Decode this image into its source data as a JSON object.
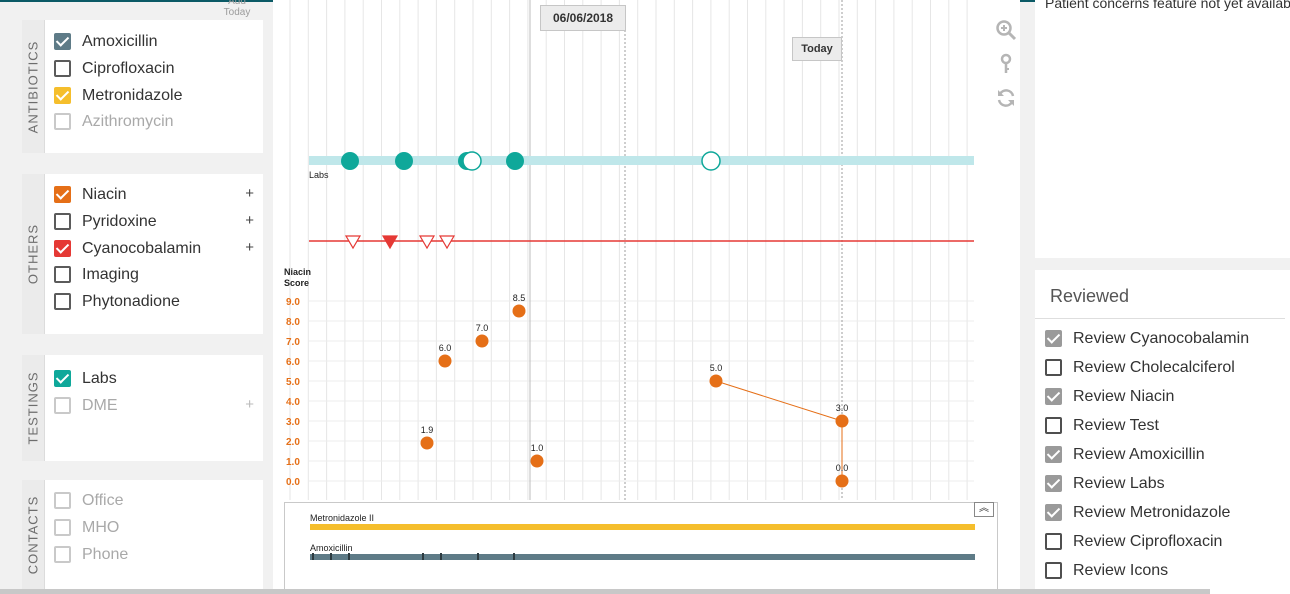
{
  "left": {
    "add_today": "Add Today",
    "groups": [
      {
        "label": "ANTIBIOTICS",
        "items": [
          {
            "label": "Amoxicillin",
            "checked": true,
            "color": "#5e7b87"
          },
          {
            "label": "Ciprofloxacin",
            "checked": false
          },
          {
            "label": "Metronidazole",
            "checked": true,
            "color": "#f5be2c"
          },
          {
            "label": "Azithromycin",
            "checked": false,
            "disabled": true
          }
        ]
      },
      {
        "label": "OTHERS",
        "items": [
          {
            "label": "Niacin",
            "checked": true,
            "color": "#e56f17",
            "plus": "+"
          },
          {
            "label": "Pyridoxine",
            "checked": false,
            "plus": "+"
          },
          {
            "label": "Cyanocobalamin",
            "checked": true,
            "color": "#e53935",
            "plus": "+"
          },
          {
            "label": "Imaging",
            "checked": false
          },
          {
            "label": "Phytonadione",
            "checked": false
          }
        ]
      },
      {
        "label": "TESTINGS",
        "items": [
          {
            "label": "Labs",
            "checked": true,
            "color": "#0fa89a"
          },
          {
            "label": "DME",
            "checked": false,
            "disabled": true,
            "plus": "+"
          }
        ]
      },
      {
        "label": "CONTACTS",
        "items": [
          {
            "label": "Office",
            "checked": false,
            "disabled": true
          },
          {
            "label": "MHO",
            "checked": false,
            "disabled": true
          },
          {
            "label": "Phone",
            "checked": false,
            "disabled": true
          }
        ]
      }
    ]
  },
  "timeline": {
    "selected_date": "06/06/2018",
    "today_label": "Today",
    "labs_label": "Labs",
    "labs_color": "#bfe7ea",
    "labs_dot_color": "#0fa89a",
    "event_line_color": "#e53935",
    "score_label_1": "Niacin",
    "score_label_2": "Score",
    "bar1_label": "Metronidazole II",
    "bar1_color": "#f5be2c",
    "bar2_label": "Amoxicillin",
    "bar2_color": "#5e7b87",
    "collapse_icon": "chevron-up-icon",
    "tools": [
      "zoom-in-icon",
      "key-icon",
      "refresh-icon"
    ]
  },
  "chart_data": {
    "type": "scatter",
    "ylabel": "Niacin Score",
    "ylim": [
      0,
      9
    ],
    "y_ticks": [
      "9.0",
      "8.0",
      "7.0",
      "6.0",
      "5.0",
      "4.0",
      "3.0",
      "2.0",
      "1.0",
      "0.0"
    ],
    "series": [
      {
        "name": "Niacin",
        "color": "#e56f17",
        "points": [
          {
            "label": "1.9",
            "y": 1.9
          },
          {
            "label": "6.0",
            "y": 6.0
          },
          {
            "label": "7.0",
            "y": 7.0
          },
          {
            "label": "8.5",
            "y": 8.5
          },
          {
            "label": "1.0",
            "y": 1.0
          },
          {
            "label": "5.0",
            "y": 5.0
          },
          {
            "label": "3.0",
            "y": 3.0
          },
          {
            "label": "0.0",
            "y": 0.0
          }
        ]
      }
    ]
  },
  "concerns": {
    "text": "Patient concerns feature not yet available"
  },
  "reviewed": {
    "title": "Reviewed",
    "items": [
      {
        "label": "Review Cyanocobalamin",
        "checked": true
      },
      {
        "label": "Review Cholecalciferol",
        "checked": false
      },
      {
        "label": "Review Niacin",
        "checked": true
      },
      {
        "label": "Review Test",
        "checked": false
      },
      {
        "label": "Review Amoxicillin",
        "checked": true
      },
      {
        "label": "Review Labs",
        "checked": true
      },
      {
        "label": "Review Metronidazole",
        "checked": true
      },
      {
        "label": "Review Ciprofloxacin",
        "checked": false
      },
      {
        "label": "Review Icons",
        "checked": false
      }
    ]
  }
}
